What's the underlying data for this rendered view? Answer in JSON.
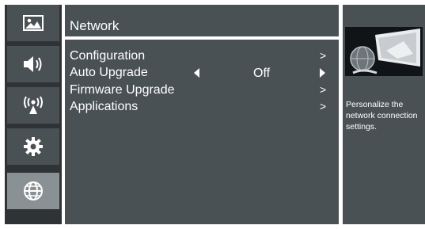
{
  "sidebar": {
    "items": [
      {
        "icon": "picture-icon"
      },
      {
        "icon": "sound-icon"
      },
      {
        "icon": "wireless-broadcast-icon"
      },
      {
        "icon": "gear-icon"
      },
      {
        "icon": "globe-icon",
        "active": true
      }
    ]
  },
  "panel": {
    "title": "Network",
    "items": [
      {
        "label": "Configuration",
        "arrow": ">"
      },
      {
        "label": "Auto Upgrade",
        "value": "Off"
      },
      {
        "label": "Firmware Upgrade",
        "arrow": ">"
      },
      {
        "label": "Applications",
        "arrow": ">"
      }
    ]
  },
  "info": {
    "description": "Personalize the network connection settings."
  },
  "colors": {
    "panel": "#4a5154",
    "active_icon": "#8a9194",
    "text": "#ffffff"
  }
}
